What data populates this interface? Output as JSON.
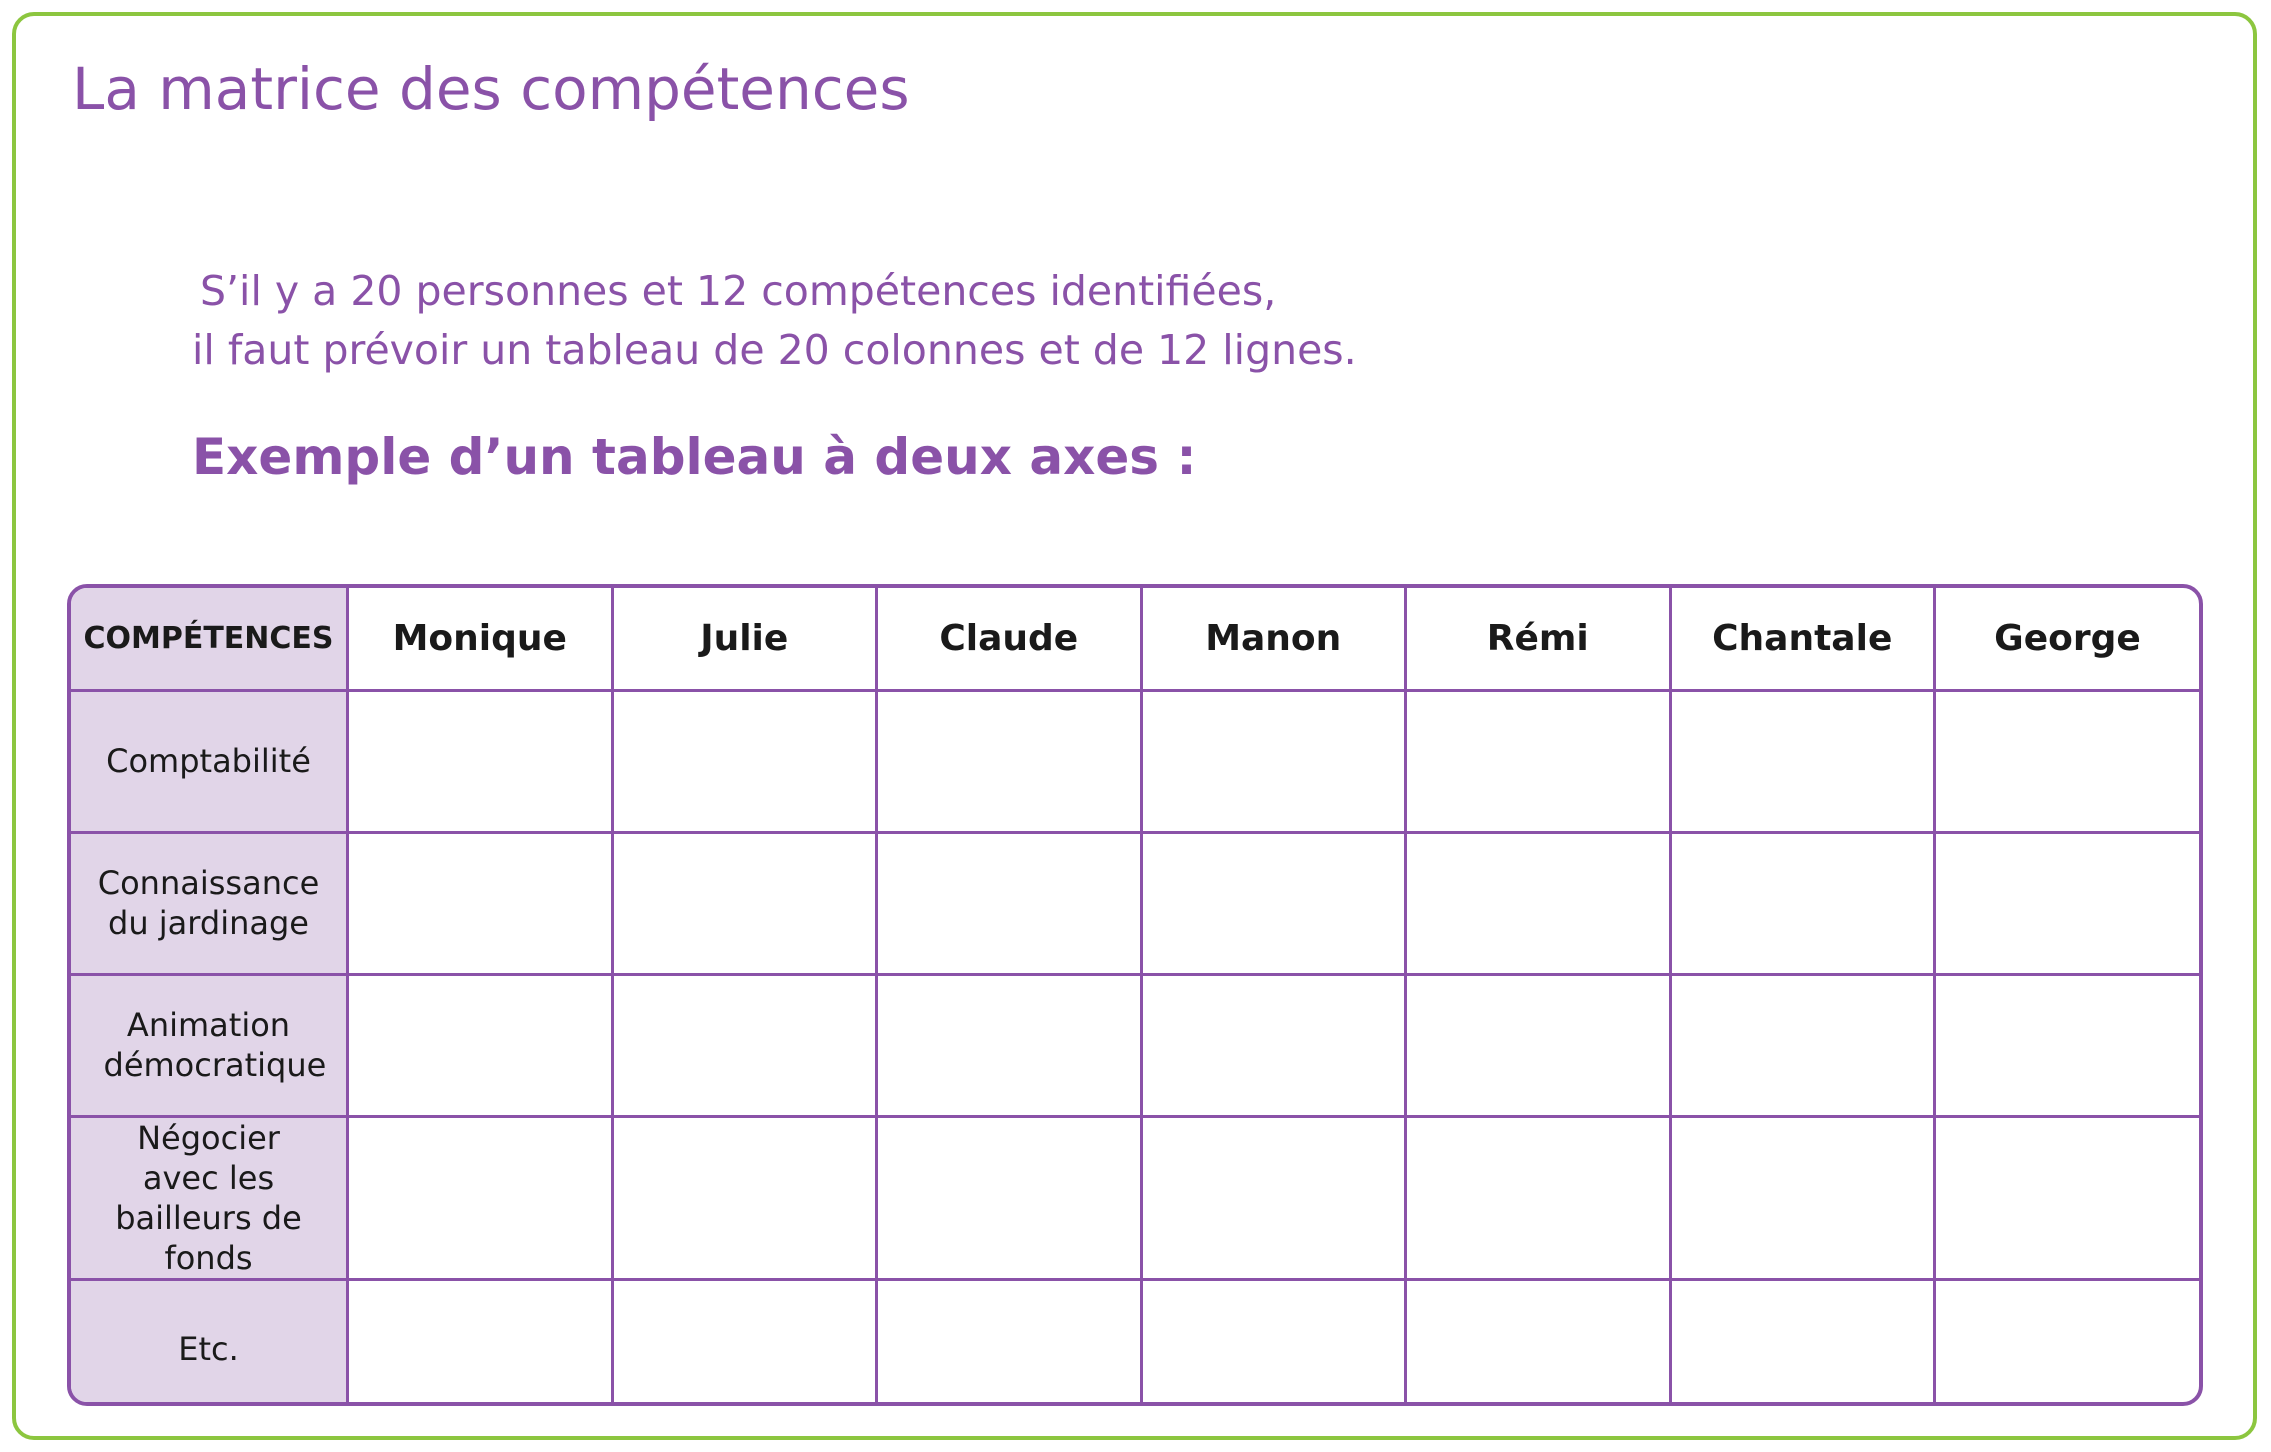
{
  "title": "La matrice des compétences",
  "intro": {
    "line1": "S’il y a 20 personnes et 12 compétences identifiées,",
    "line2": "il faut prévoir un tableau de 20 colonnes et de 12 lignes."
  },
  "subtitle": "Exemple d’un tableau à deux axes :",
  "colors": {
    "frame_border": "#8cc63f",
    "accent_purple": "#8a52a8",
    "header_fill": "#e1d5e8"
  },
  "matrix": {
    "corner_label": "COMPÉTENCES",
    "people": [
      "Monique",
      "Julie",
      "Claude",
      "Manon",
      "Rémi",
      "Chantale",
      "George"
    ],
    "skills": [
      "Comptabilité",
      "Connaissance du jardinage",
      "Animation démocratique",
      "Négocier avec les bailleurs de fonds",
      "Etc."
    ]
  }
}
